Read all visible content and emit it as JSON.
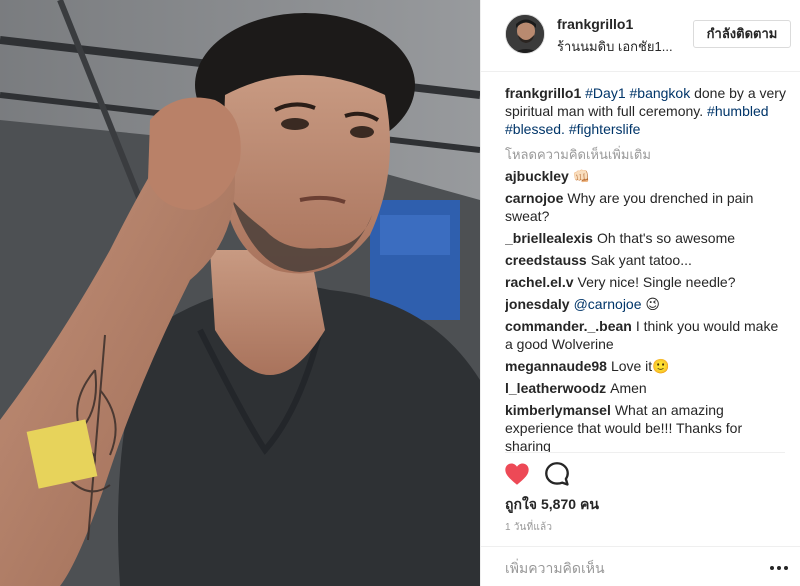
{
  "header": {
    "username": "frankgrillo1",
    "location": "ร้านนมดิบ เอกชัย1...",
    "follow_label": "กำลังติดตาม"
  },
  "caption": {
    "username": "frankgrillo1",
    "hashtag_day1": "#Day1",
    "hashtag_bangkok": "#bangkok",
    "text_1": " done by a very spiritual man with full ceremony. ",
    "hashtag_humbled": "#humbled",
    "hashtag_blessed": "#blessed.",
    "hashtag_fighterslife": "#fighterslife"
  },
  "load_more_label": "โหลดความคิดเห็นเพิ่มเติม",
  "comments": [
    {
      "user": "ajbuckley",
      "text": "👊🏻"
    },
    {
      "user": "carnojoe",
      "text": "Why are you drenched in pain sweat?"
    },
    {
      "user": "_briellealexis",
      "text": "Oh that's so awesome"
    },
    {
      "user": "creedstauss",
      "text": "Sak yant tatoo..."
    },
    {
      "user": "rachel.el.v",
      "text": "Very nice! Single needle?"
    },
    {
      "user": "jonesdaly",
      "mention": "@carnojoe",
      "text": " 😉"
    },
    {
      "user": "commander._.bean",
      "text": "I think you would make a good Wolverine"
    },
    {
      "user": "megannaude98",
      "text": "Love it🙂"
    },
    {
      "user": "l_leatherwoodz",
      "text": "Amen"
    },
    {
      "user": "kimberlymansel",
      "text": "What an amazing experience that would be!!! Thanks for sharing"
    }
  ],
  "actions": {
    "heart_icon": "heart-filled-icon",
    "comment_icon": "comment-bubble-icon",
    "heart_color": "#ed4956"
  },
  "likes": {
    "label": "ถูกใจ",
    "count": "5,870",
    "unit": "คน"
  },
  "timestamp": "1 วันที่แล้ว",
  "add_comment": {
    "placeholder": "เพิ่มความคิดเห็น"
  },
  "colors": {
    "hashtag": "#003569",
    "muted": "#999999",
    "border": "#efefef"
  }
}
